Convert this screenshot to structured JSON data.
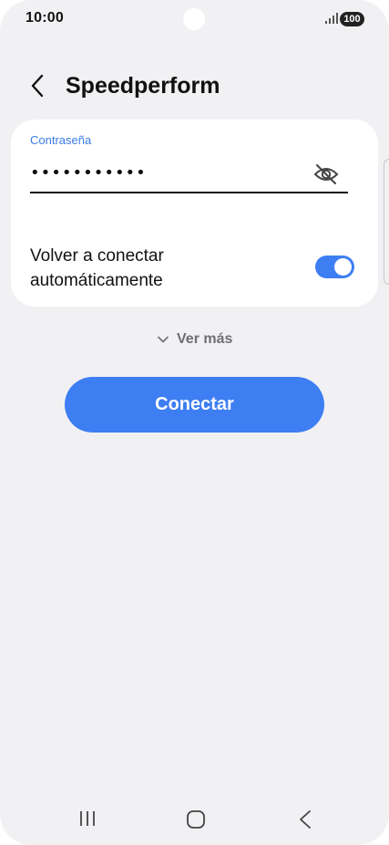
{
  "status_bar": {
    "time": "10:00",
    "battery": "100",
    "signal_icon": "signal-bars-icon"
  },
  "header": {
    "back_icon": "chevron-left-icon",
    "title": "Speedperform"
  },
  "password_field": {
    "label": "Contraseña",
    "value": "•••••••••••",
    "visibility_icon": "eye-off-icon"
  },
  "auto_reconnect": {
    "label": "Volver a conectar automáticamente",
    "enabled": true
  },
  "more": {
    "label": "Ver más",
    "icon": "chevron-down-icon"
  },
  "connect_button": {
    "label": "Conectar"
  },
  "nav_bar": {
    "recent_icon": "recent-apps-icon",
    "home_icon": "home-icon",
    "back_icon": "back-icon"
  },
  "colors": {
    "accent": "#3e7ef3",
    "label_blue": "#3a7ce6",
    "background": "#f1f1f4",
    "card": "#ffffff"
  }
}
